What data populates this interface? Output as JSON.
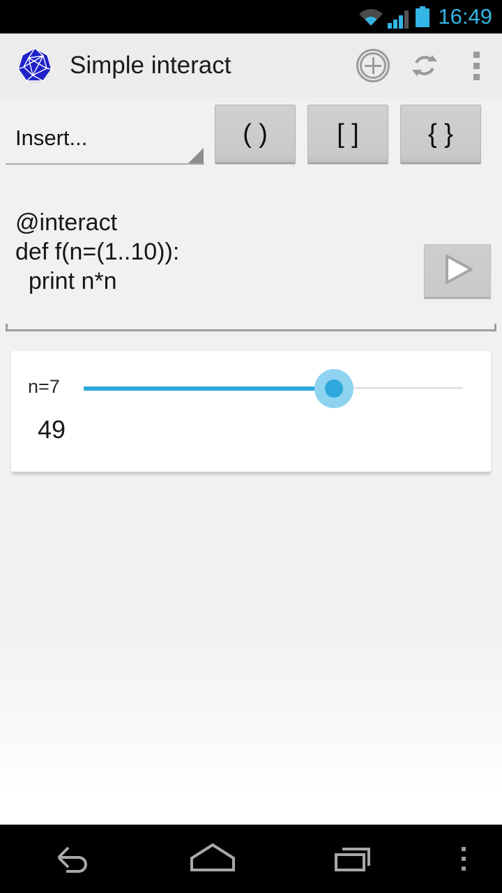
{
  "status_bar": {
    "time": "16:49",
    "icons": [
      "wifi-icon",
      "signal-icon",
      "battery-icon"
    ],
    "accent_color": "#33b5e5",
    "background": "#000000"
  },
  "action_bar": {
    "app_icon": "sage-polyhedron-icon",
    "title": "Simple interact",
    "actions": [
      {
        "name": "new-icon",
        "label": "New"
      },
      {
        "name": "refresh-icon",
        "label": "Refresh"
      },
      {
        "name": "overflow-menu-icon",
        "label": "More options"
      }
    ],
    "background": "#ececec"
  },
  "toolbar": {
    "spinner": {
      "selected": "Insert...",
      "placeholder": "Insert..."
    },
    "buttons": [
      {
        "label": "( )",
        "name": "insert-parentheses-button"
      },
      {
        "label": "[ ]",
        "name": "insert-brackets-button"
      },
      {
        "label": "{ }",
        "name": "insert-braces-button"
      }
    ]
  },
  "editor": {
    "code": "@interact\ndef f(n=(1..10)):\n  print n*n",
    "run_button_label": "Run",
    "run_icon": "play-icon"
  },
  "output": {
    "slider": {
      "label": "n=7",
      "variable": "n",
      "value": 7,
      "min": 1,
      "max": 10,
      "fill_percent": 66,
      "track_color": "#2fa8dd",
      "halo_color": "#8ed3ef",
      "track_bg_color": "#d8d8d8"
    },
    "result": "49"
  },
  "nav_bar": {
    "buttons": [
      {
        "name": "back-icon",
        "label": "Back"
      },
      {
        "name": "home-icon",
        "label": "Home"
      },
      {
        "name": "recents-icon",
        "label": "Recent apps"
      },
      {
        "name": "menu-dots-icon",
        "label": "Menu"
      }
    ],
    "background": "#000000"
  }
}
